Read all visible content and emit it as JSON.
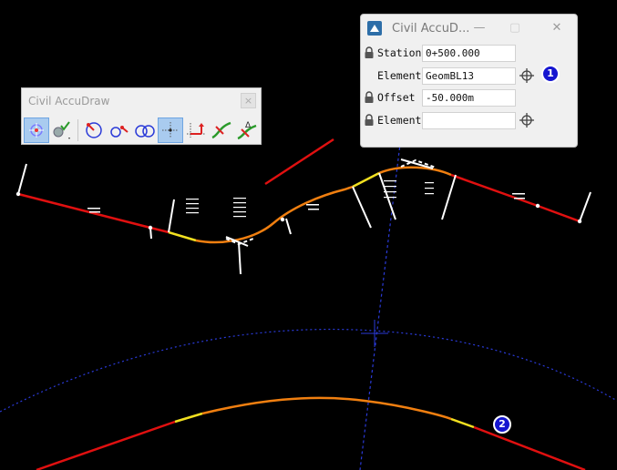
{
  "toolbar": {
    "title": "Civil AccuDraw",
    "close_glyph": "×",
    "tools": [
      {
        "name": "accudraw-compass-tool",
        "icon": "compass-icon",
        "active": true
      },
      {
        "name": "check-options-tool",
        "icon": "check-dropdown-icon",
        "active": false
      },
      {
        "name": "distance-direction-tool",
        "icon": "circle-arrow-icon",
        "active": false
      },
      {
        "name": "distance-distance-tool",
        "icon": "double-circle-arrow-icon",
        "active": false
      },
      {
        "name": "double-circle-tool",
        "icon": "double-circle-icon",
        "active": false
      },
      {
        "name": "xy-tool",
        "icon": "crosshair-dots-icon",
        "active": true
      },
      {
        "name": "dx-dy-tool",
        "icon": "dx-dy-icon",
        "active": false
      },
      {
        "name": "station-offset-tool",
        "icon": "station-offset-icon",
        "active": false
      },
      {
        "name": "delta-station-tool",
        "icon": "delta-station-icon",
        "active": false
      }
    ]
  },
  "dialog": {
    "title": "Civil AccuD...",
    "minimize_glyph": "—",
    "maximize_glyph": "▢",
    "close_glyph": "✕",
    "rows": [
      {
        "label": "Station",
        "value": "0+500.000",
        "has_lock": true,
        "has_target": false
      },
      {
        "label": "Element",
        "value": "GeomBL13",
        "has_lock": false,
        "has_target": true
      },
      {
        "label": "Offset",
        "value": "-50.000m",
        "has_lock": true,
        "has_target": false
      },
      {
        "label": "Element",
        "value": "",
        "has_lock": true,
        "has_target": true
      }
    ]
  },
  "callouts": [
    "1",
    "2"
  ],
  "colors": {
    "tangent": "#e01010",
    "arc": "#f07f10",
    "transition": "#f2e020",
    "construction": "#2a3ad8",
    "annotation": "#ffffff",
    "background": "#000000",
    "badge": "#1515d0"
  }
}
